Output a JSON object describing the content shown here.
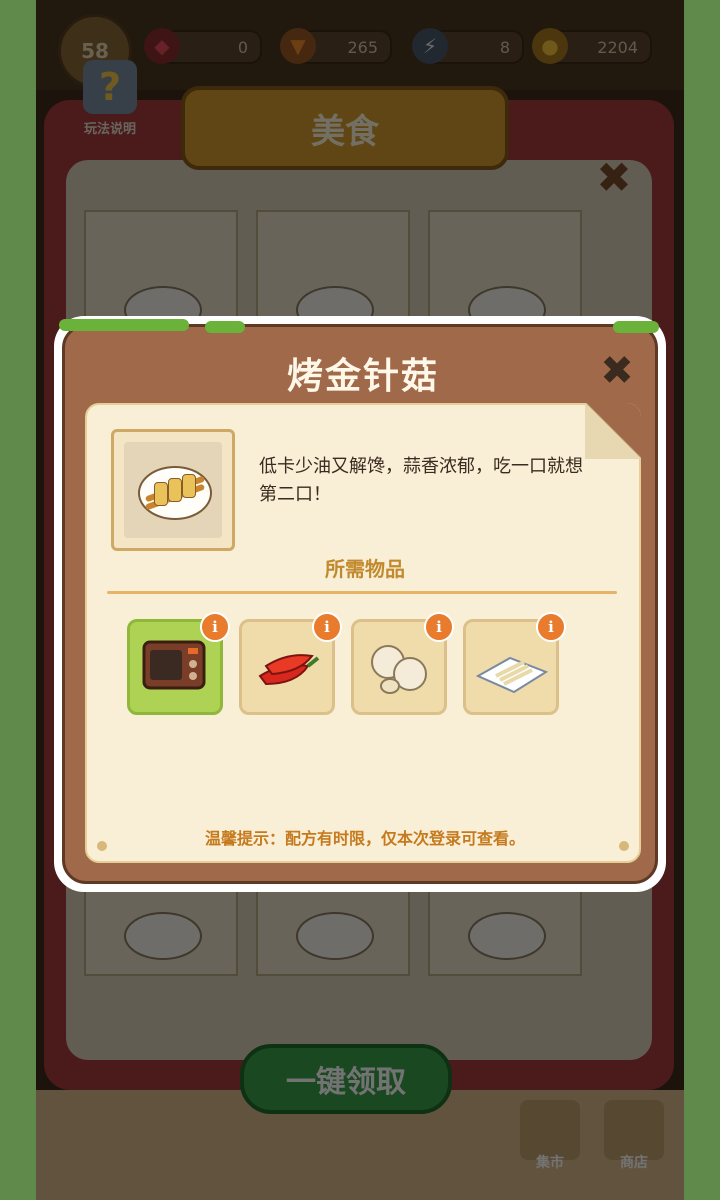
{
  "resources": {
    "level": "58",
    "gems": "0",
    "carrots": "265",
    "energy": "8",
    "coins": "2204"
  },
  "help": {
    "label": "玩法说明"
  },
  "panel": {
    "banner": "美食",
    "claim_button": "一键领取",
    "nav": [
      "集市",
      "商店"
    ]
  },
  "modal": {
    "title": "烤金针菇",
    "description": "低卡少油又解馋，蒜香浓郁，吃一口就想第二口！",
    "required_label": "所需物品",
    "items": [
      {
        "name": "oven-icon",
        "selected": true
      },
      {
        "name": "chili-pepper-icon",
        "selected": false
      },
      {
        "name": "garlic-icon",
        "selected": false
      },
      {
        "name": "enoki-mushroom-icon",
        "selected": false
      }
    ],
    "info_badge": "i",
    "tip": "温馨提示：配方有时限，仅本次登录可查看。"
  },
  "colors": {
    "modal_brown": "#a06a4a",
    "title_text": "#fff7e8",
    "required_label": "#c28a2e",
    "tip_text": "#c57a1e",
    "selected_item": "#aed254",
    "info_badge": "#e87b2c"
  }
}
